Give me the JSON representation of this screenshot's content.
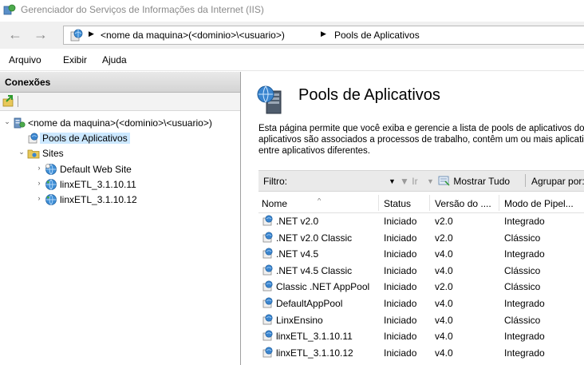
{
  "window": {
    "title": "Gerenciador do Serviços de Informações da Internet (IIS)"
  },
  "address": {
    "segments": [
      "<nome da maquina>(<dominio>\\<usuario>)",
      "Pools de Aplicativos"
    ]
  },
  "menu": {
    "items": [
      "Arquivo",
      "Exibir",
      "Ajuda"
    ]
  },
  "connections": {
    "header": "Conexões",
    "tree": [
      {
        "label": "<nome da maquina>(<dominio>\\<usuario>)",
        "icon": "server-icon"
      },
      {
        "label": "Pools de Aplicativos",
        "icon": "app-pool-icon",
        "selected": true
      },
      {
        "label": "Sites",
        "icon": "folder-icon"
      },
      {
        "label": "Default Web Site",
        "icon": "globe-icon"
      },
      {
        "label": "linxETL_3.1.10.11",
        "icon": "globe-icon"
      },
      {
        "label": "linxETL_3.1.10.12",
        "icon": "globe-icon"
      }
    ]
  },
  "main": {
    "title": "Pools de Aplicativos",
    "description_lines": [
      "Esta página permite que você exiba e gerencie a lista de pools de aplicativos do servidor. Os pools de",
      "aplicativos são associados a processos de trabalho, contêm um ou mais aplicativos e fornecem isolamento",
      "entre aplicativos diferentes."
    ],
    "filter": {
      "label": "Filtro:",
      "go": "Ir",
      "show_all": "Mostrar Tudo",
      "group_by": "Agrupar por:"
    },
    "columns": [
      "Nome",
      "Status",
      "Versão do ....",
      "Modo de Pipel..."
    ],
    "rows": [
      {
        "name": ".NET v2.0",
        "status": "Iniciado",
        "version": "v2.0",
        "mode": "Integrado"
      },
      {
        "name": ".NET v2.0 Classic",
        "status": "Iniciado",
        "version": "v2.0",
        "mode": "Clássico"
      },
      {
        "name": ".NET v4.5",
        "status": "Iniciado",
        "version": "v4.0",
        "mode": "Integrado"
      },
      {
        "name": ".NET v4.5 Classic",
        "status": "Iniciado",
        "version": "v4.0",
        "mode": "Clássico"
      },
      {
        "name": "Classic .NET AppPool",
        "status": "Iniciado",
        "version": "v2.0",
        "mode": "Clássico"
      },
      {
        "name": "DefaultAppPool",
        "status": "Iniciado",
        "version": "v4.0",
        "mode": "Integrado"
      },
      {
        "name": "LinxEnsino",
        "status": "Iniciado",
        "version": "v4.0",
        "mode": "Clássico"
      },
      {
        "name": "linxETL_3.1.10.11",
        "status": "Iniciado",
        "version": "v4.0",
        "mode": "Integrado"
      },
      {
        "name": "linxETL_3.1.10.12",
        "status": "Iniciado",
        "version": "v4.0",
        "mode": "Integrado"
      }
    ]
  }
}
